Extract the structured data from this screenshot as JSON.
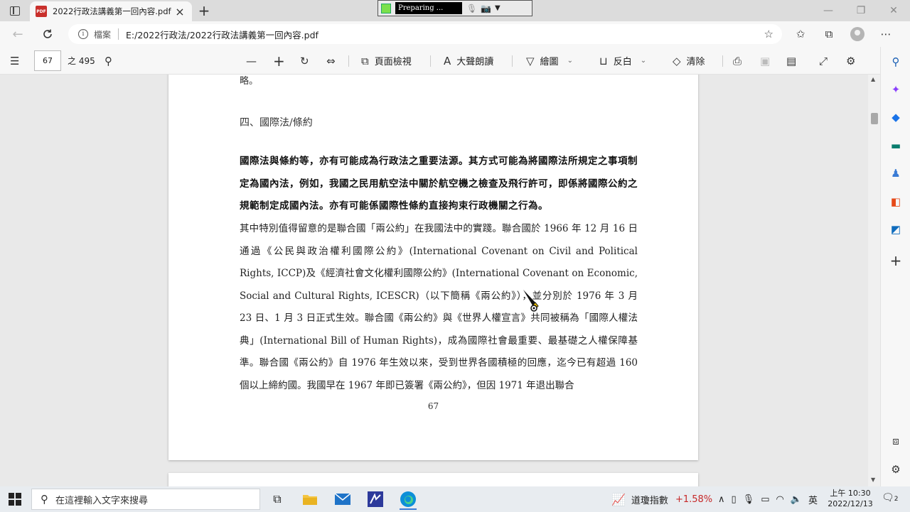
{
  "browser": {
    "tab_title": "2022行政法講義第一回內容.pdf",
    "tab_close": "×",
    "new_tab": "+",
    "pdf_badge": "PDF",
    "address_file_label": "檔案",
    "address_url": "E:/2022行政法/2022行政法講義第一回內容.pdf",
    "window_controls": [
      "—",
      "❐",
      "✕"
    ]
  },
  "recorder": {
    "status": "Preparing ...",
    "arrow": "▼"
  },
  "pdf_toolbar": {
    "page_value": "67",
    "page_total": "之 495",
    "page_view": "頁面檢視",
    "read_aloud": "大聲朗讀",
    "draw": "繪圖",
    "highlight": "反白",
    "erase": "清除"
  },
  "document": {
    "prev_line_end": "略。",
    "heading": "四、國際法/條約",
    "bold_paragraph": "國際法與條約等，亦有可能成為行政法之重要法源。其方式可能為將國際法所規定之事項制定為國內法，例如，我國之民用航空法中關於航空機之檢查及飛行許可，即係將國際公約之規範制定成國內法。亦有可能係國際性條約直接拘束行政機關之行為。",
    "body_paragraph": "其中特別值得留意的是聯合國「兩公約」在我國法中的實踐。聯合國於 1966 年 12 月 16 日通過《公民與政治權利國際公約》(International Covenant on Civil and Political Rights, ICCP)及《經濟社會文化權利國際公約》(International Covenant on Economic, Social and Cultural Rights, ICESCR)（以下簡稱《兩公約》），並分別於 1976 年 3 月 23 日、1 月 3 日正式生效。聯合國《兩公約》與《世界人權宣言》共同被稱為「國際人權法典」(International Bill of Human Rights)，成為國際社會最重要、最基礎之人權保障基準。聯合國《兩公約》自 1976 年生效以來，受到世界各國積極的回應，迄今已有超過 160 個以上締約國。我國早在 1967 年即已簽署《兩公約》，但因 1971 年退出聯合",
    "page_number": "67"
  },
  "taskbar": {
    "search_placeholder": "在這裡輸入文字來搜尋",
    "stock_name": "道瓊指數",
    "stock_change": "+1.58%",
    "ime_lang": "英",
    "time": "上午 10:30",
    "date": "2022/12/13",
    "notif_count": "2"
  },
  "colors": {
    "accent": "#3a7bd5",
    "pdf_red": "#c9302c",
    "stock_red": "#c62828",
    "recorder_green": "#7be04b"
  }
}
